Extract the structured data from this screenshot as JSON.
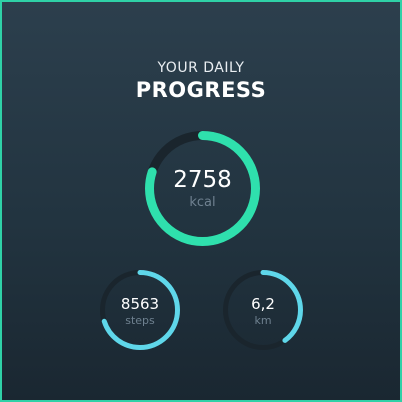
{
  "header": {
    "subtitle": "YOUR DAILY",
    "title": "PROGRESS"
  },
  "colors": {
    "border": "#2fd1a7",
    "kcal_ring": "#2fe0ad",
    "small_ring": "#5fd7ea",
    "track": "#1a252d"
  },
  "rings": {
    "kcal": {
      "value": "2758",
      "unit": "kcal",
      "progress": 0.8
    },
    "steps": {
      "value": "8563",
      "unit": "steps",
      "progress": 0.7
    },
    "km": {
      "value": "6,2",
      "unit": "km",
      "progress": 0.4
    }
  }
}
